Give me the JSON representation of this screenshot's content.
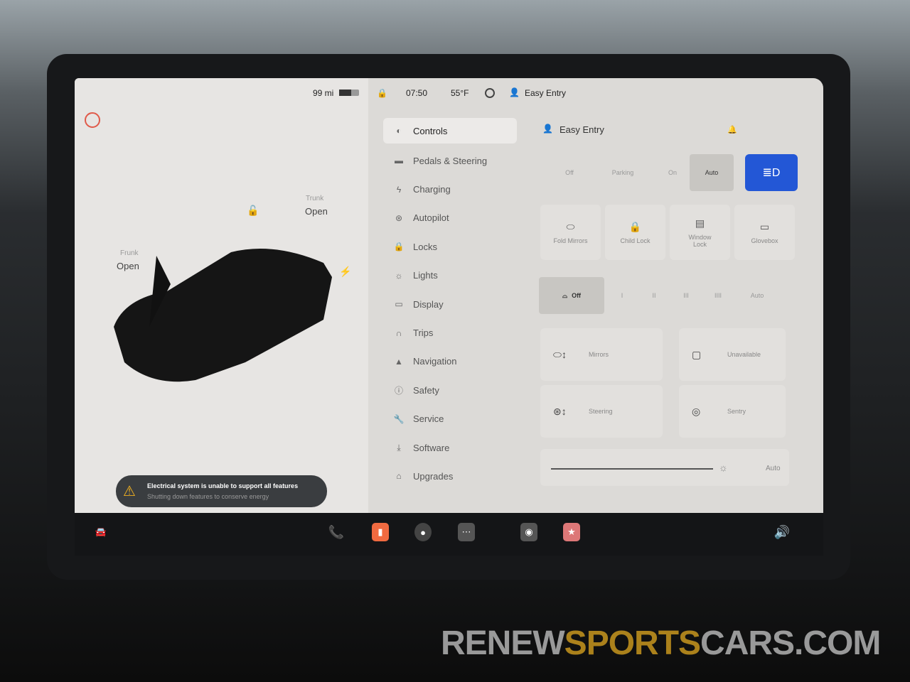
{
  "status": {
    "range": "99 mi",
    "time": "07:50",
    "temp": "55°F",
    "profile": "Easy Entry"
  },
  "left": {
    "frunk_label": "Frunk",
    "frunk_state": "Open",
    "trunk_label": "Trunk",
    "trunk_state": "Open"
  },
  "alert": {
    "title": "Electrical system is unable to support all features",
    "subtitle": "Shutting down features to conserve energy"
  },
  "menu": [
    {
      "label": "Controls",
      "icon": "toggle-icon",
      "active": true
    },
    {
      "label": "Pedals & Steering",
      "icon": "car-icon"
    },
    {
      "label": "Charging",
      "icon": "bolt-icon"
    },
    {
      "label": "Autopilot",
      "icon": "steering-wheel-icon"
    },
    {
      "label": "Locks",
      "icon": "lock-icon"
    },
    {
      "label": "Lights",
      "icon": "sun-icon"
    },
    {
      "label": "Display",
      "icon": "display-icon"
    },
    {
      "label": "Trips",
      "icon": "trips-icon"
    },
    {
      "label": "Navigation",
      "icon": "navigation-icon"
    },
    {
      "label": "Safety",
      "icon": "info-icon"
    },
    {
      "label": "Service",
      "icon": "wrench-icon"
    },
    {
      "label": "Software",
      "icon": "download-icon"
    },
    {
      "label": "Upgrades",
      "icon": "bag-icon"
    }
  ],
  "controls": {
    "profile": "Easy Entry",
    "lights": {
      "options": [
        "Off",
        "Parking",
        "On",
        "Auto"
      ],
      "selected": "Auto",
      "accent": "#2357d6"
    },
    "quick": [
      {
        "label": "Fold Mirrors"
      },
      {
        "label": "Child Lock"
      },
      {
        "label": "Window Lock"
      },
      {
        "label": "Glovebox"
      }
    ],
    "wipers": {
      "options": [
        "Off",
        "I",
        "II",
        "III",
        "IIII",
        "Auto"
      ],
      "selected": "Off"
    },
    "adjust": [
      {
        "label": "Mirrors"
      },
      {
        "label": "Unavailable"
      },
      {
        "label": "Steering"
      },
      {
        "label": "Sentry"
      }
    ],
    "brightness": {
      "label": "Auto",
      "level": 0.95
    }
  },
  "watermark": {
    "a": "RENEW",
    "b": "SPORTS",
    "c": "CARS.COM"
  }
}
